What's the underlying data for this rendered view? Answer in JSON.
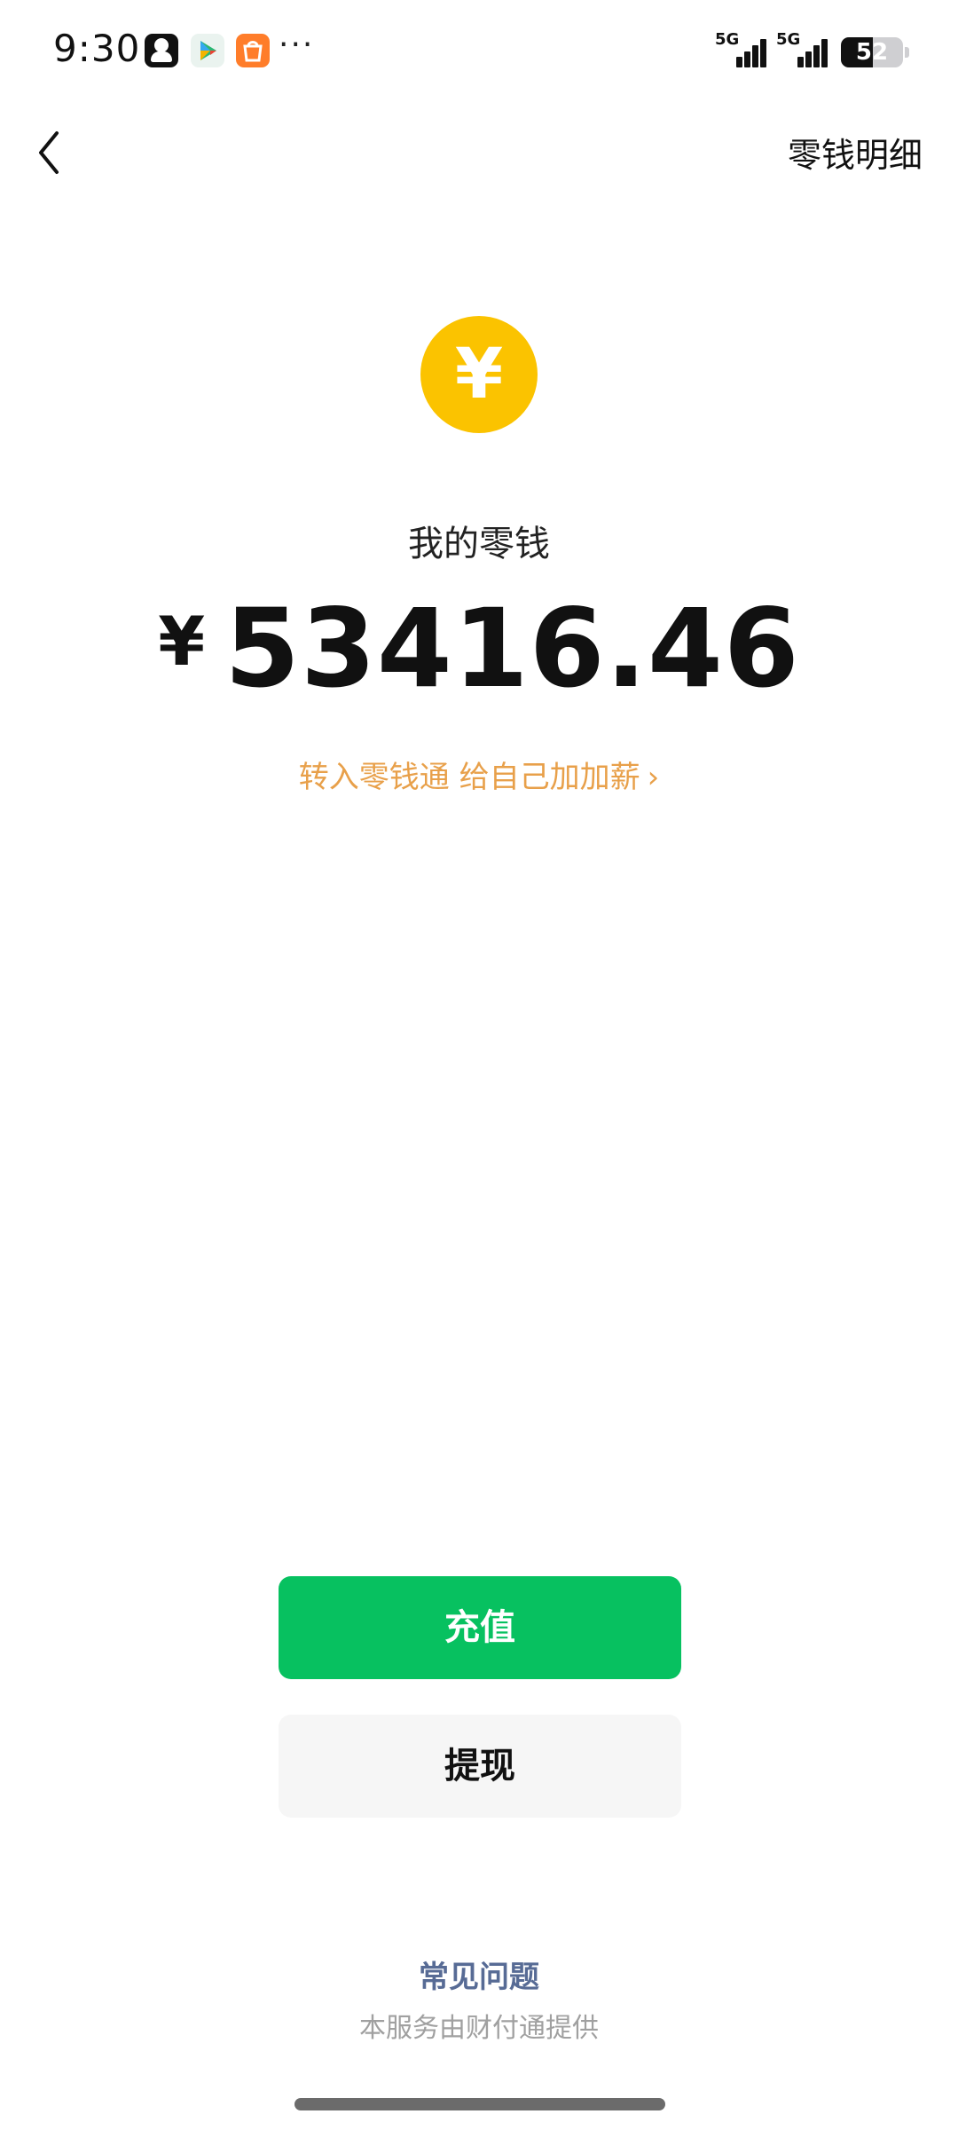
{
  "status_bar": {
    "time": "9:30",
    "more": "···",
    "signal1_label": "5G",
    "signal2_label": "5G",
    "battery_level": "52",
    "apps": [
      "person-app-icon",
      "play-store-icon",
      "shopping-bag-icon"
    ]
  },
  "nav": {
    "back_icon": "chevron-left-icon",
    "detail_label": "零钱明细"
  },
  "wallet": {
    "coin_symbol": "¥",
    "title": "我的零钱",
    "currency": "¥",
    "balance": "53416.46",
    "promo_text": "转入零钱通 给自己加加薪",
    "promo_chevron": "›",
    "coin_color": "#fbc300",
    "promo_color": "#e8a04a"
  },
  "actions": {
    "recharge_label": "充值",
    "withdraw_label": "提现",
    "recharge_color": "#07c160"
  },
  "footer": {
    "faq_label": "常见问题",
    "provider_text": "本服务由财付通提供",
    "faq_color": "#576b95"
  }
}
